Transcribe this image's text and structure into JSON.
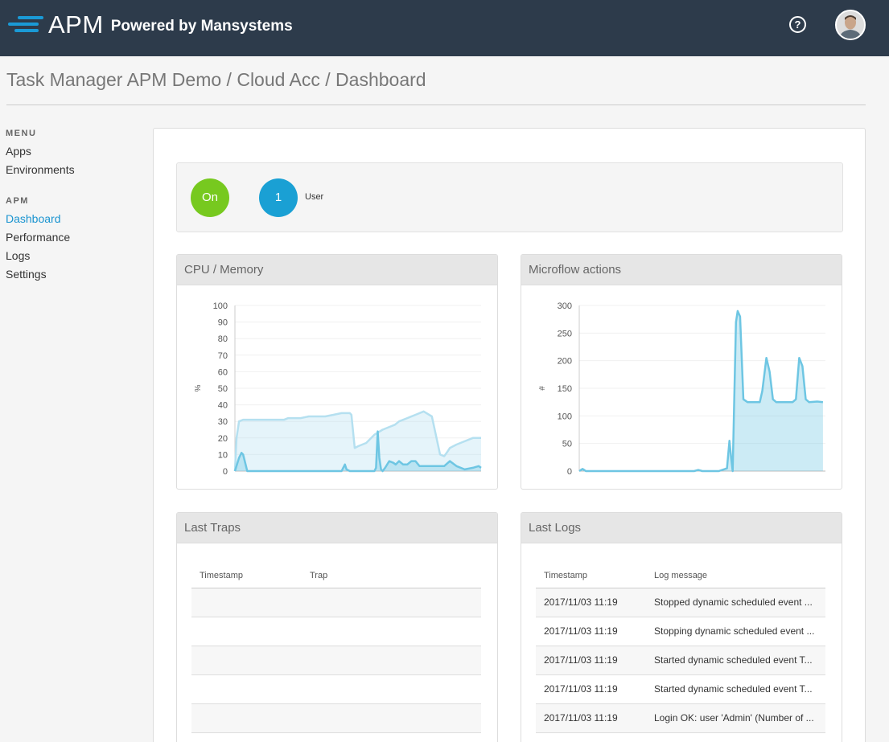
{
  "header": {
    "logo_text": "APM",
    "powered_by": "Powered by Mansystems",
    "help_icon": "question-circle-icon",
    "avatar_icon": "user-avatar-icon"
  },
  "breadcrumb": "Task Manager APM Demo / Cloud Acc / Dashboard",
  "sidebar": {
    "menu_heading": "MENU",
    "menu_items": [
      {
        "label": "Apps"
      },
      {
        "label": "Environments"
      }
    ],
    "apm_heading": "APM",
    "apm_items": [
      {
        "label": "Dashboard",
        "active": true
      },
      {
        "label": "Performance"
      },
      {
        "label": "Logs"
      },
      {
        "label": "Settings"
      }
    ]
  },
  "status": {
    "state": "On",
    "user_count": "1",
    "user_label": "User",
    "colors": {
      "on": "#77c91f",
      "users": "#1aa0d4"
    }
  },
  "cards": {
    "cpu_title": "CPU / Memory",
    "microflow_title": "Microflow actions",
    "traps_title": "Last Traps",
    "logs_title": "Last Logs"
  },
  "chart_data": [
    {
      "type": "area",
      "ylabel": "%",
      "ylim": [
        0,
        100
      ],
      "yticks": [
        0,
        10,
        20,
        30,
        40,
        50,
        60,
        70,
        80,
        90,
        100
      ],
      "grid": true,
      "series": [
        {
          "color": "#b5e0f0",
          "x": [
            0,
            2,
            5,
            10,
            20,
            30,
            40,
            50,
            60,
            65,
            70,
            80,
            90,
            100,
            110,
            120,
            130,
            138,
            140,
            142,
            146,
            150,
            160,
            170,
            180,
            190,
            195,
            200,
            210,
            220,
            230,
            240,
            250,
            255,
            258,
            262,
            270,
            280,
            290,
            300
          ],
          "values": [
            0,
            20,
            30,
            31,
            31,
            31,
            31,
            31,
            31,
            32,
            32,
            32,
            33,
            33,
            33,
            34,
            35,
            35,
            35,
            34,
            14,
            15,
            17,
            22,
            25,
            27,
            28,
            30,
            32,
            34,
            36,
            33,
            10,
            9,
            11,
            14,
            16,
            18,
            20,
            20
          ]
        },
        {
          "color": "#6ec6e3",
          "x": [
            0,
            5,
            8,
            10,
            13,
            15,
            20,
            40,
            60,
            80,
            100,
            120,
            130,
            132,
            134,
            136,
            140,
            150,
            160,
            170,
            172,
            174,
            176,
            178,
            180,
            183,
            188,
            193,
            196,
            200,
            205,
            210,
            215,
            220,
            225,
            230,
            240,
            250,
            255,
            262,
            270,
            280,
            290,
            297,
            300
          ],
          "values": [
            0,
            8,
            11,
            10,
            4,
            0,
            0,
            0,
            0,
            0,
            0,
            0,
            0,
            2,
            4,
            1,
            0,
            0,
            0,
            0,
            2,
            24,
            8,
            1,
            0,
            2,
            6,
            5,
            4,
            6,
            4,
            4,
            6,
            6,
            3,
            3,
            3,
            3,
            3,
            6,
            3,
            1,
            2,
            3,
            2
          ]
        }
      ]
    },
    {
      "type": "area",
      "ylabel": "#",
      "ylim": [
        0,
        300
      ],
      "yticks": [
        0,
        50,
        100,
        150,
        200,
        250,
        300
      ],
      "grid": true,
      "series": [
        {
          "color": "#6ec6e3",
          "x": [
            0,
            2,
            4,
            6,
            8,
            10,
            20,
            40,
            60,
            80,
            100,
            120,
            130,
            140,
            145,
            150,
            160,
            170,
            180,
            183,
            185,
            187,
            189,
            191,
            193,
            196,
            200,
            205,
            210,
            220,
            223,
            228,
            232,
            236,
            240,
            245,
            250,
            255,
            260,
            264,
            268,
            272,
            276,
            280,
            290,
            297
          ],
          "values": [
            0,
            2,
            4,
            2,
            0,
            0,
            0,
            0,
            0,
            0,
            0,
            0,
            0,
            0,
            2,
            0,
            0,
            0,
            5,
            55,
            25,
            0,
            140,
            270,
            290,
            280,
            130,
            125,
            125,
            125,
            145,
            205,
            180,
            130,
            125,
            125,
            125,
            125,
            125,
            130,
            205,
            190,
            130,
            125,
            126,
            125
          ]
        }
      ]
    }
  ],
  "traps_table": {
    "columns": [
      "Timestamp",
      "Trap"
    ],
    "rows": [
      [
        "",
        ""
      ],
      [
        "",
        ""
      ],
      [
        "",
        ""
      ],
      [
        "",
        ""
      ],
      [
        "",
        ""
      ]
    ]
  },
  "logs_table": {
    "columns": [
      "Timestamp",
      "Log message"
    ],
    "rows": [
      [
        "2017/11/03 11:19",
        "Stopped dynamic scheduled event ..."
      ],
      [
        "2017/11/03 11:19",
        "Stopping dynamic scheduled event ..."
      ],
      [
        "2017/11/03 11:19",
        "Started dynamic scheduled event T..."
      ],
      [
        "2017/11/03 11:19",
        "Started dynamic scheduled event T..."
      ],
      [
        "2017/11/03 11:19",
        "Login OK: user 'Admin' (Number of ..."
      ]
    ]
  }
}
